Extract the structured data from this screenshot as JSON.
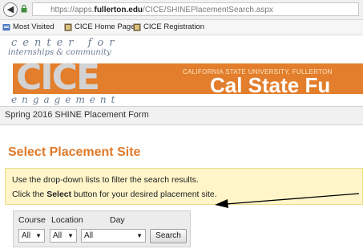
{
  "browser": {
    "url_prefix": "https://apps.",
    "url_domain": "fullerton.edu",
    "url_path": "/CICE/SHINEPlacementSearch.aspx"
  },
  "bookmarks": [
    {
      "label": "Most Visited"
    },
    {
      "label": "CICE Home Page"
    },
    {
      "label": "CICE Registration"
    }
  ],
  "banner": {
    "tagline_top": "center for",
    "tagline_middle": "internships & community",
    "logo_text": "CICE",
    "tagline_bottom": "engagement",
    "university": "CALIFORNIA STATE UNIVERSITY, FULLERTON",
    "cal_state": "Cal State Fu",
    "accent_color": "#e27e2c"
  },
  "form_title": "Spring 2016 SHINE Placement Form",
  "page_title": "Select Placement Site",
  "notice": {
    "line1": "Use the drop-down lists to filter the search results.",
    "line2_pre": "Click the ",
    "line2_bold": "Select",
    "line2_post": " button for your desired placement site."
  },
  "filters": {
    "course_label": "Course",
    "location_label": "Location",
    "day_label": "Day",
    "course_value": "All",
    "location_value": "All",
    "day_value": "All",
    "search_label": "Search"
  }
}
